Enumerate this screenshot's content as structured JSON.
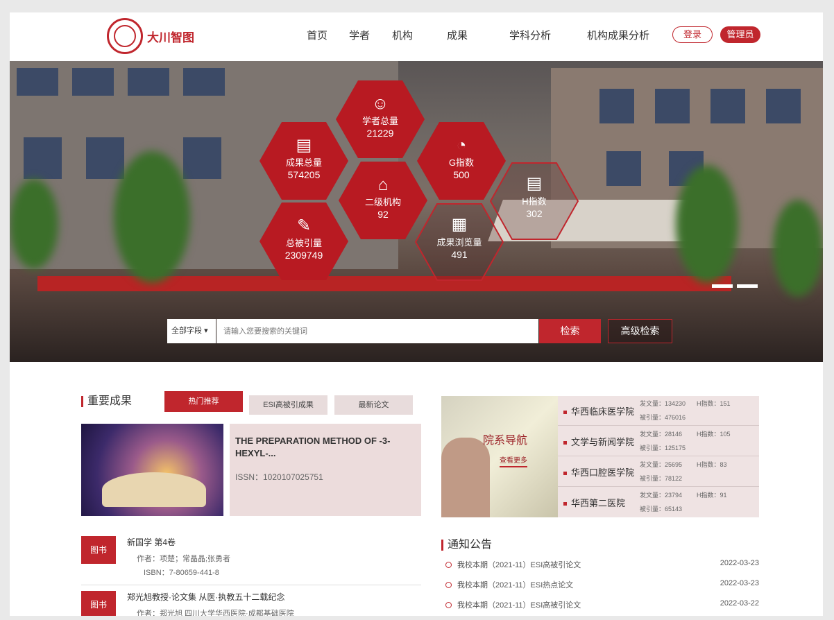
{
  "header": {
    "logo_text": "大川智图",
    "nav": [
      "首页",
      "学者",
      "机构",
      "成果",
      "学科分析",
      "机构成果分析"
    ],
    "login": "登录",
    "admin": "管理员"
  },
  "hero": {
    "stats": [
      {
        "label": "学者总量",
        "value": "21229",
        "icon": "person-icon"
      },
      {
        "label": "成果总量",
        "value": "574205",
        "icon": "bar-chart-icon"
      },
      {
        "label": "G指数",
        "value": "500",
        "icon": "pie-chart-icon"
      },
      {
        "label": "二级机构",
        "value": "92",
        "icon": "building-icon"
      },
      {
        "label": "H指数",
        "value": "302",
        "icon": "document-icon"
      },
      {
        "label": "总被引量",
        "value": "2309749",
        "icon": "edit-icon"
      },
      {
        "label": "成果浏览量",
        "value": "491",
        "icon": "calendar-icon"
      }
    ],
    "search_select": "全部字段",
    "search_placeholder": "请输入您要搜索的关键词",
    "search_button": "检索",
    "advanced_button": "高级检索"
  },
  "results": {
    "title": "重要成果",
    "tabs": [
      "热门推荐",
      "ESI高被引成果",
      "最新论文"
    ],
    "featured": {
      "title": "THE PREPARATION METHOD OF -3-HEXYL-...",
      "issn": "ISSN：1020107025751"
    },
    "list": [
      {
        "tag": "图书",
        "title": "新国学 第4卷",
        "author": "作者：项楚；常晶晶;张勇者",
        "isbn": "ISBN：7-80659-441-8"
      },
      {
        "tag": "图书",
        "title": "郑光旭教授·论文集 从医·执教五十二载纪念",
        "author": "作者：郑光旭 四川大学华西医院·成都基础医院",
        "isbn": ""
      }
    ]
  },
  "departments": {
    "heading": "院系导航",
    "more": "查看更多",
    "items": [
      {
        "name": "华西临床医学院",
        "papers": "发文量：134230",
        "h": "H指数：151",
        "cites": "被引量：476016"
      },
      {
        "name": "文学与新闻学院",
        "papers": "发文量：28146",
        "h": "H指数：105",
        "cites": "被引量：125175"
      },
      {
        "name": "华西口腔医学院",
        "papers": "发文量：25695",
        "h": "H指数：83",
        "cites": "被引量：78122"
      },
      {
        "name": "华西第二医院",
        "papers": "发文量：23794",
        "h": "H指数：91",
        "cites": "被引量：65143"
      }
    ]
  },
  "notices": {
    "title": "通知公告",
    "items": [
      {
        "text": "我校本期（2021-11）ESI高被引论文",
        "date": "2022-03-23"
      },
      {
        "text": "我校本期（2021-11）ESI热点论文",
        "date": "2022-03-23"
      },
      {
        "text": "我校本期（2021-11）ESI高被引论文",
        "date": "2022-03-22"
      }
    ]
  },
  "colors": {
    "accent": "#c0262d"
  }
}
